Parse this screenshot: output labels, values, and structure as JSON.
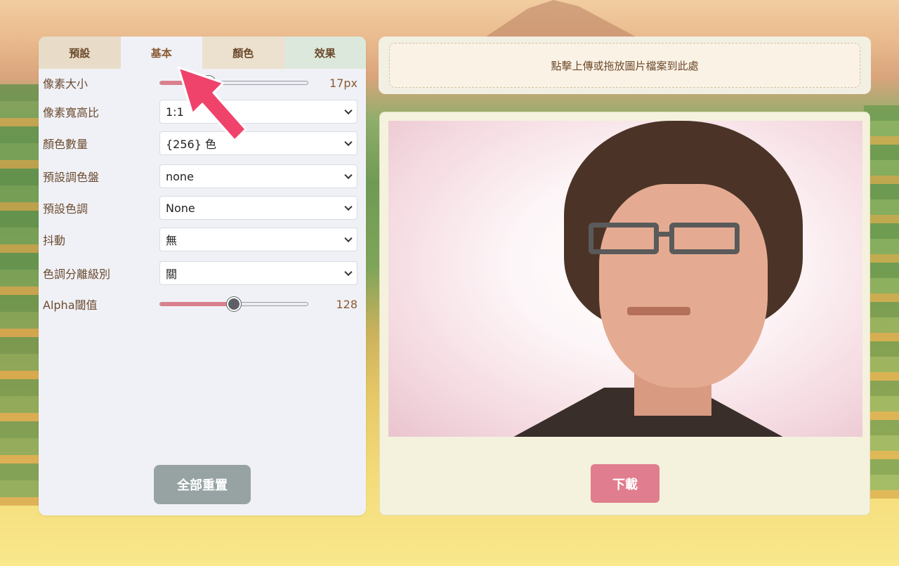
{
  "tabs": [
    {
      "label": "預設"
    },
    {
      "label": "基本"
    },
    {
      "label": "顏色"
    },
    {
      "label": "效果"
    }
  ],
  "active_tab": "基本",
  "settings": {
    "pixel_size": {
      "label": "像素大小",
      "value_text": "17px",
      "fraction": 0.33
    },
    "aspect_ratio": {
      "label": "像素寬高比",
      "value": "1:1"
    },
    "color_count": {
      "label": "顏色數量",
      "value": "{256} 色"
    },
    "palette": {
      "label": "預設調色盤",
      "value": "none"
    },
    "tone": {
      "label": "預設色調",
      "value": "None"
    },
    "dither": {
      "label": "抖動",
      "value": "無"
    },
    "posterize": {
      "label": "色調分離級別",
      "value": "關"
    },
    "alpha": {
      "label": "Alpha閾值",
      "value_text": "128",
      "fraction": 0.5
    }
  },
  "buttons": {
    "reset": "全部重置",
    "download": "下載"
  },
  "upload": {
    "prompt": "點擊上傳或拖放圖片檔案到此處"
  },
  "colors": {
    "accent": "#e07d8e",
    "slider_fill": "#d97f8e",
    "text_brown": "#6a4a30",
    "reset_button": "#97a3a3",
    "annotation_arrow": "#f0436b"
  },
  "icons": [
    "chevron-down-icon",
    "pointer-arrow-icon"
  ]
}
